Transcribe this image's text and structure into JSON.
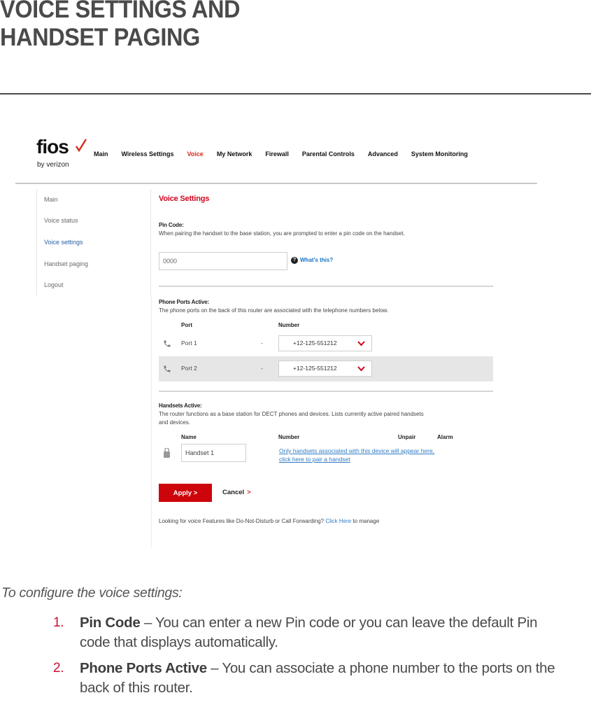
{
  "document": {
    "title_lines": [
      "VOICE SETTINGS AND",
      "HANDSET PAGING"
    ]
  },
  "router_ui": {
    "logo": {
      "brand": "fios",
      "sub": "by verizon",
      "accent_color": "#d52b1e"
    },
    "top_nav": [
      {
        "label": "Main",
        "active": false
      },
      {
        "label": "Wireless Settings",
        "active": false
      },
      {
        "label": "Voice",
        "active": true
      },
      {
        "label": "My Network",
        "active": false
      },
      {
        "label": "Firewall",
        "active": false
      },
      {
        "label": "Parental Controls",
        "active": false
      },
      {
        "label": "Advanced",
        "active": false
      },
      {
        "label": "System Monitoring",
        "active": false
      }
    ],
    "sidebar": [
      {
        "label": "Main",
        "active": false
      },
      {
        "label": "Voice status",
        "active": false
      },
      {
        "label": "Voice settings",
        "active": true
      },
      {
        "label": "Handset paging",
        "active": false
      },
      {
        "label": "Logout",
        "active": false
      }
    ],
    "main": {
      "section_title": "Voice Settings",
      "pin": {
        "label": "Pin Code:",
        "description": "When pairing the handset to the base station, you are prompted to enter a pin code on the handset.",
        "value": "0000",
        "help_icon": "question-circle-icon",
        "help_link": "What's this?"
      },
      "ports": {
        "label": "Phone Ports Active:",
        "description": "The phone ports on the back of this router are associated with the telephone numbers below.",
        "columns": [
          "Port",
          "Number"
        ],
        "rows": [
          {
            "icon": "phone-icon",
            "port": "Port 1",
            "separator": "-",
            "number": "+12-125-551212"
          },
          {
            "icon": "phone-icon",
            "port": "Port 2",
            "separator": "-",
            "number": "+12-125-551212"
          }
        ]
      },
      "handsets": {
        "label": "Handsets Active:",
        "description_line1": "The router functions as a base station for DECT phones and devices. Lists currently active paired handsets",
        "description_line2": "and devices.",
        "columns": [
          "Name",
          "Number",
          "Unpair",
          "Alarm"
        ],
        "rows": [
          {
            "icon": "handset-icon",
            "name": "Handset 1"
          }
        ],
        "info_link_line1": "Only handsets associated with this device will appear here,",
        "info_link_line2": "click here to pair a handset"
      },
      "actions": {
        "apply": "Apply  >",
        "cancel": "Cancel",
        "cancel_arrow": ">"
      },
      "footer": {
        "prefix": "Looking for voice Features like Do-Not-Disturb or Call Forwarding? ",
        "link": "Click Here",
        "suffix": " to manage"
      }
    }
  },
  "instructions": {
    "intro": "To configure the voice settings:",
    "steps": [
      {
        "number": "1.",
        "term": "Pin Code",
        "text": " – You can enter a new Pin code or you can leave the default Pin code that displays automatically."
      },
      {
        "number": "2.",
        "term": "Phone Ports Active",
        "text": " – You can associate a phone number to the ports on the back of this router."
      }
    ]
  }
}
